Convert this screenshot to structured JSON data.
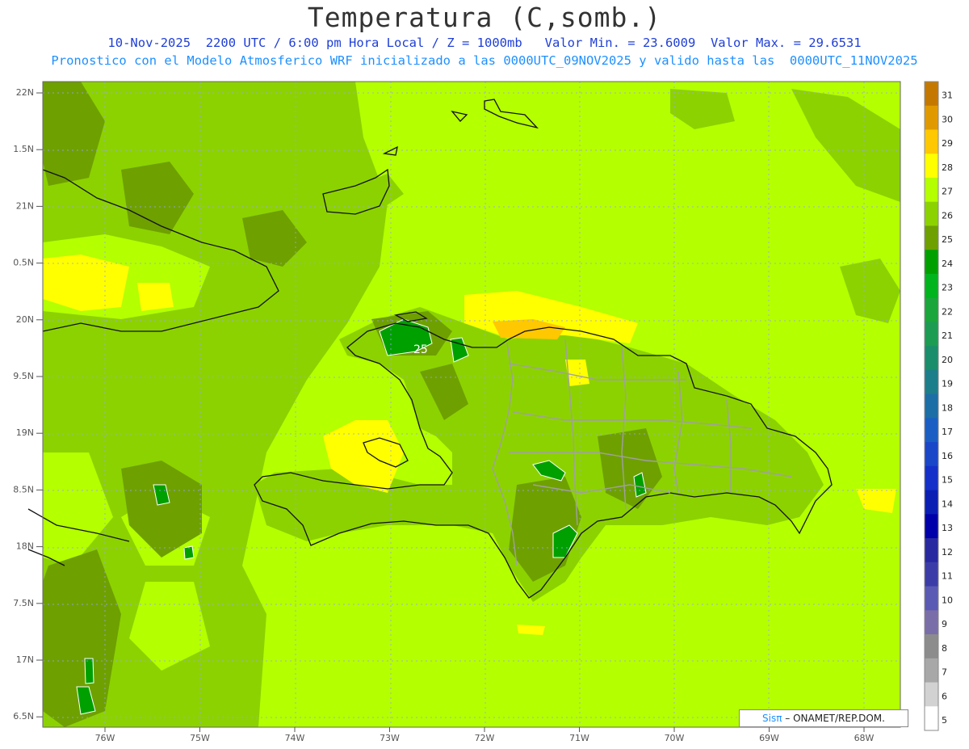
{
  "header": {
    "title": "Temperatura (C,somb.)",
    "line1": "10-Nov-2025  2200 UTC / 6:00 pm Hora Local / Z = 1000mb   Valor Min. = 23.6009  Valor Max. = 29.6531",
    "line2": "Pronostico con el Modelo Atmosferico WRF inicializado a las 0000UTC_09NOV2025 y valido hasta las  0000UTC_11NOV2025"
  },
  "axes": {
    "lat_labels": [
      "22N",
      "1.5N",
      "21N",
      "0.5N",
      "20N",
      "9.5N",
      "19N",
      "8.5N",
      "18N",
      "7.5N",
      "17N",
      "6.5N"
    ],
    "lon_labels": [
      "76W",
      "75W",
      "74W",
      "73W",
      "72W",
      "71W",
      "70W",
      "69W",
      "68W"
    ]
  },
  "contour_label": "25",
  "colorbar": {
    "labels": [
      "31",
      "30",
      "29",
      "28",
      "27",
      "26",
      "25",
      "24",
      "23",
      "22",
      "21",
      "20",
      "19",
      "18",
      "17",
      "16",
      "15",
      "14",
      "13",
      "12",
      "11",
      "10",
      "9",
      "8",
      "7",
      "6",
      "5"
    ],
    "colors": [
      "#c47800",
      "#e09a00",
      "#ffc800",
      "#ffff00",
      "#b4ff00",
      "#8cd200",
      "#6ea000",
      "#00a000",
      "#00b41e",
      "#1aa63a",
      "#1c9c52",
      "#1a8e6a",
      "#1c7e8a",
      "#1c6ea6",
      "#1a5ec4",
      "#1a46c8",
      "#1430c8",
      "#0a1eb4",
      "#0000aa",
      "#2828a0",
      "#3c3ca8",
      "#5a5ab4",
      "#7a6ea8",
      "#8c8c8c",
      "#a8a8a8",
      "#d2d2d2",
      "#ffffff"
    ]
  },
  "credit": {
    "sis": "Sisπ",
    "text": " – ONAMET/REP.DOM."
  }
}
